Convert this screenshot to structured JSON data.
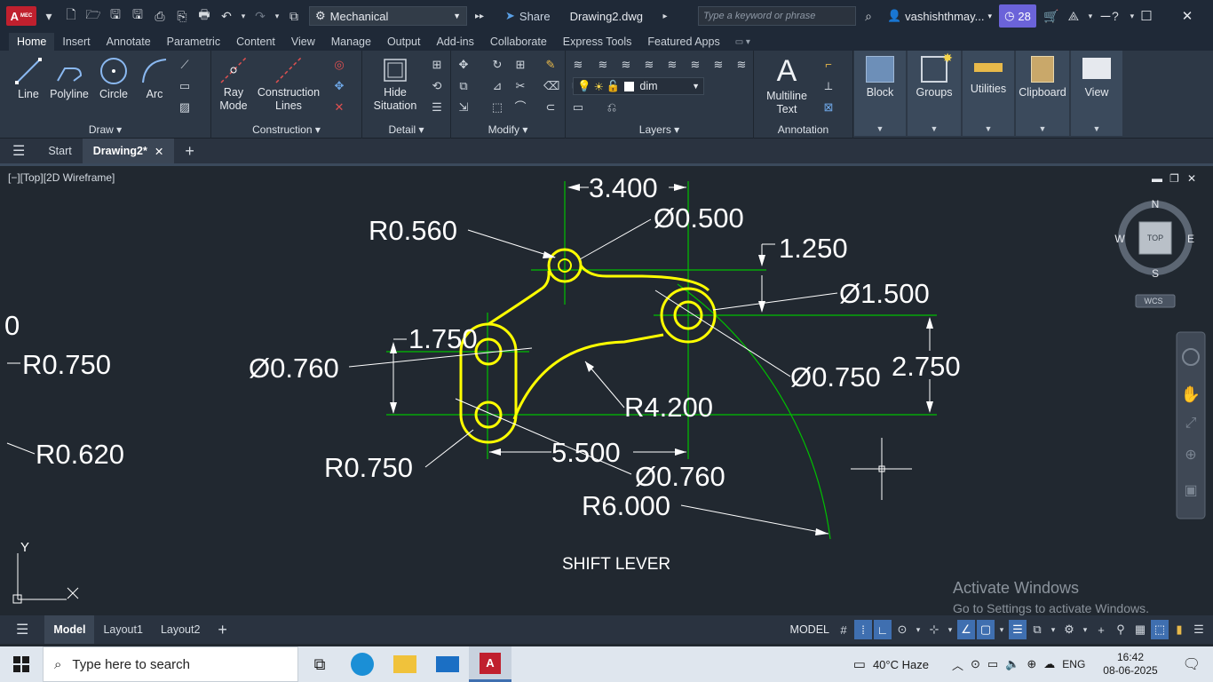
{
  "titlebar": {
    "app_badge": "A",
    "app_badge_sub": "MEC",
    "workspace": "Mechanical",
    "share_label": "Share",
    "document_title": "Drawing2.dwg",
    "search_placeholder": "Type a keyword or phrase",
    "user_name": "vashishthmay...",
    "notification_count": "28"
  },
  "ribbon_tabs": [
    "Home",
    "Insert",
    "Annotate",
    "Parametric",
    "Content",
    "View",
    "Manage",
    "Output",
    "Add-ins",
    "Collaborate",
    "Express Tools",
    "Featured Apps"
  ],
  "ribbon": {
    "draw": {
      "title": "Draw",
      "line": "Line",
      "polyline": "Polyline",
      "circle": "Circle",
      "arc": "Arc"
    },
    "construction": {
      "title": "Construction",
      "ray1": "Ray",
      "ray2": "Mode",
      "cl1": "Construction",
      "cl2": "Lines"
    },
    "detail": {
      "title": "Detail",
      "hs1": "Hide",
      "hs2": "Situation"
    },
    "modify": {
      "title": "Modify"
    },
    "layers": {
      "title": "Layers",
      "current_layer": "dim"
    },
    "annotation": {
      "title": "Annotation",
      "mt1": "Multiline",
      "mt2": "Text"
    },
    "blocks": {
      "block": "Block",
      "groups": "Groups",
      "utilities": "Utilities",
      "clipboard": "Clipboard",
      "view": "View"
    }
  },
  "doc_tabs": {
    "start": "Start",
    "drawing": "Drawing2*"
  },
  "viewport": {
    "label": "[−][Top][2D Wireframe]",
    "viewcube_top": "TOP",
    "n": "N",
    "s": "S",
    "e": "E",
    "w": "W",
    "wcs": "WCS"
  },
  "drawing": {
    "dims": {
      "d1": "3.400",
      "d2": "R0.560",
      "d3": "Ø0.500",
      "d4": "1.250",
      "d5": "Ø1.500",
      "d6": "1.750",
      "d7": "Ø0.760",
      "d8": "Ø0.750",
      "d9": "2.750",
      "d10": "R4.200",
      "d11": "5.500",
      "d12": "R0.750",
      "d13": "Ø0.760",
      "d14": "R6.000",
      "e1": "0",
      "e2": "R0.750",
      "e3": "R0.620"
    },
    "title_text": "SHIFT LEVER",
    "ucs_y": "Y"
  },
  "activate": {
    "line1": "Activate Windows",
    "line2": "Go to Settings to activate Windows."
  },
  "status": {
    "model_tab": "Model",
    "layout1": "Layout1",
    "layout2": "Layout2",
    "model_btn": "MODEL"
  },
  "taskbar": {
    "search_placeholder": "Type here to search",
    "weather": "40°C  Haze",
    "lang": "ENG",
    "time": "16:42",
    "date": "08-06-2025"
  },
  "colors": {
    "ribbon": "#2d3846",
    "canvas": "#212830",
    "geometry": "#ffff00",
    "construction": "#00c000",
    "dimension": "#ffffff",
    "accent": "#3f6fb0"
  }
}
